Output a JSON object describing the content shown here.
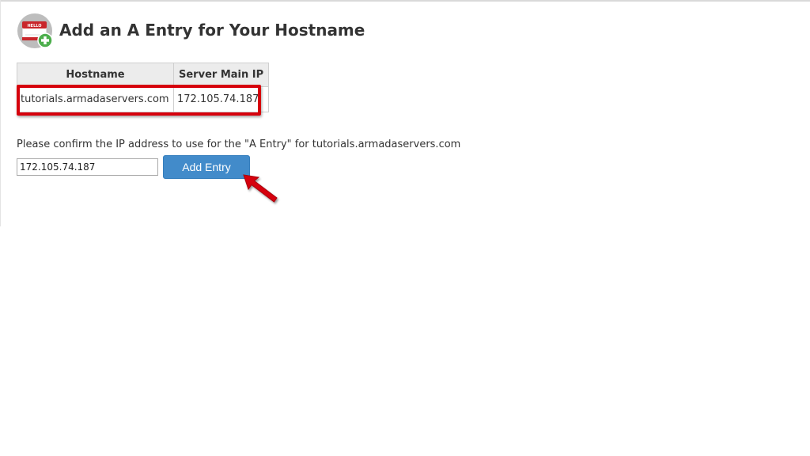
{
  "header": {
    "title": "Add an A Entry for Your Hostname",
    "icon": "hello-name-tag-add-icon",
    "icon_badge_text": "HELLO"
  },
  "table": {
    "columns": [
      "Hostname",
      "Server Main IP"
    ],
    "rows": [
      {
        "hostname": "tutorials.armadaservers.com",
        "ip": "172.105.74.187"
      }
    ]
  },
  "form": {
    "confirm_text": "Please confirm the IP address to use for the \"A Entry\" for tutorials.armadaservers.com",
    "ip_value": "172.105.74.187",
    "add_button_label": "Add Entry"
  },
  "annotations": {
    "highlight_color": "#d6000c",
    "arrow_color": "#d6000c",
    "button_color": "#428bca"
  }
}
